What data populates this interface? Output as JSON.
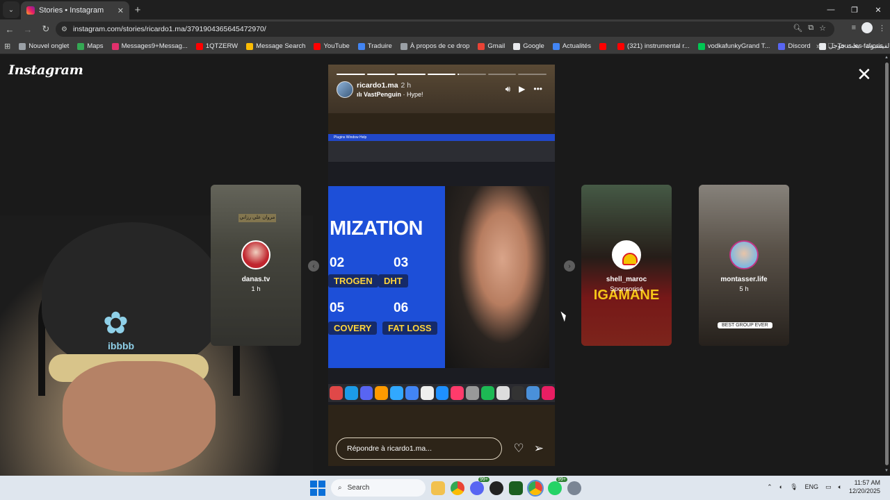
{
  "browser": {
    "tab_title": "Stories • Instagram",
    "url": "instagram.com/stories/ricardo1.ma/3791904365645472970/",
    "bookmarks": [
      {
        "label": "Nouvel onglet",
        "color": "#9aa0a6"
      },
      {
        "label": "Maps",
        "color": "#34a853"
      },
      {
        "label": "Messages9+Messag...",
        "color": "#e1306c"
      },
      {
        "label": "1QTZERW",
        "color": "#ff0000"
      },
      {
        "label": "Message Search",
        "color": "#fbbc04"
      },
      {
        "label": "YouTube",
        "color": "#ff0000"
      },
      {
        "label": "Traduire",
        "color": "#4285f4"
      },
      {
        "label": "À propos de ce drop",
        "color": "#9aa0a6"
      },
      {
        "label": "Gmail",
        "color": "#ea4335"
      },
      {
        "label": "Google",
        "color": "#e8eaed"
      },
      {
        "label": "Actualités",
        "color": "#4285f4"
      },
      {
        "label": "",
        "color": "#ff0000"
      },
      {
        "label": "(321) instrumental r...",
        "color": "#ff0000"
      },
      {
        "label": "vodkafunkyGrand T...",
        "color": "#00c853"
      },
      {
        "label": "Discord",
        "color": "#5865f2"
      },
      {
        "label": "الفيسبوك - بحث جوجل",
        "color": "#e8eaed"
      }
    ],
    "all_bookmarks": "Tous les favoris"
  },
  "instagram": {
    "logo": "Instagram",
    "story": {
      "username": "ricardo1.ma",
      "time": "2 h",
      "music_artist": "VastPenguin",
      "music_title": "Hype!",
      "reply_placeholder": "Répondre à ricardo1.ma...",
      "progress_segments": 7,
      "progress_completed": 4,
      "progress_current_fraction": 0.05,
      "slide_title": "MIZATION",
      "slide_numbers": [
        "02",
        "03",
        "05",
        "06"
      ],
      "slide_labels": [
        "TROGEN",
        "DHT",
        "COVERY",
        "FAT LOSS"
      ],
      "menubar_items": "Plugins   Window   Help"
    },
    "previews": [
      {
        "name": "danas.tv",
        "sub": "1 h",
        "top_text": "مروان علي رزاني"
      },
      {
        "name": "shell_maroc",
        "sub": "Sponsorisé",
        "overlay_text": "IGAMANE"
      },
      {
        "name": "montasser.life",
        "sub": "5 h",
        "tag": "BEST GROUP EVER"
      }
    ]
  },
  "webcam": {
    "beanie_text": "ibbbb"
  },
  "taskbar": {
    "search_label": "Search",
    "badge1": "99+",
    "badge2": "99+",
    "language": "ENG",
    "time": "11:57 AM",
    "date": "12/20/2025"
  }
}
